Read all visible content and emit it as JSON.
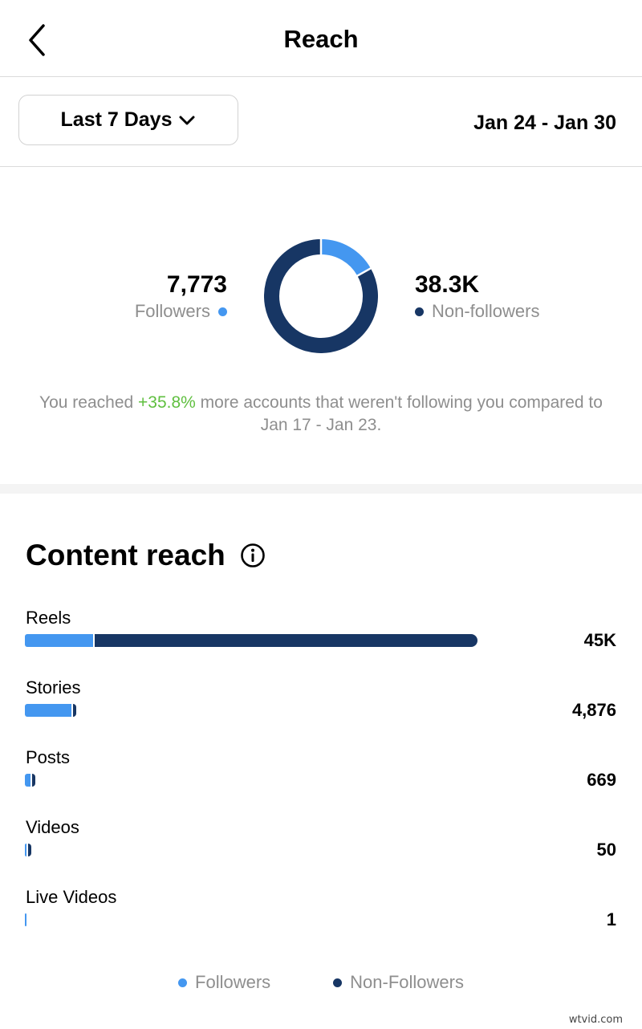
{
  "header": {
    "title": "Reach",
    "back_icon": "chevron-left-icon"
  },
  "filters": {
    "range_label": "Last 7 Days",
    "range_icon": "chevron-down-icon",
    "date_range": "Jan 24 - Jan 30"
  },
  "summary": {
    "followers": {
      "value": "7,773",
      "label": "Followers"
    },
    "non_followers": {
      "value": "38.3K",
      "label": "Non-followers"
    },
    "text_prefix": "You reached ",
    "percent": "+35.8%",
    "text_suffix": " more accounts that weren't following you compared to Jan 17 - Jan 23."
  },
  "content_reach": {
    "title": "Content reach",
    "info_icon": "info-circle-icon",
    "rows": [
      {
        "label": "Reels",
        "value": "45K"
      },
      {
        "label": "Stories",
        "value": "4,876"
      },
      {
        "label": "Posts",
        "value": "669"
      },
      {
        "label": "Videos",
        "value": "50"
      },
      {
        "label": "Live Videos",
        "value": "1"
      }
    ],
    "legend": {
      "followers": "Followers",
      "non_followers": "Non-Followers"
    }
  },
  "colors": {
    "followers": "#4497f0",
    "non_followers": "#173664",
    "positive": "#5fbf3f",
    "muted_text": "#8e8e8e"
  },
  "chart_data": [
    {
      "type": "pie",
      "categories": [
        "Followers",
        "Non-followers"
      ],
      "values": [
        7773,
        38300
      ]
    },
    {
      "type": "bar",
      "categories": [
        "Reels",
        "Stories",
        "Posts",
        "Videos",
        "Live Videos"
      ],
      "series": [
        {
          "name": "Followers",
          "values": [
            6800,
            4650,
            600,
            40,
            1
          ]
        },
        {
          "name": "Non-Followers",
          "values": [
            38200,
            226,
            69,
            10,
            0
          ]
        }
      ]
    }
  ],
  "watermark": "wtvid.com"
}
